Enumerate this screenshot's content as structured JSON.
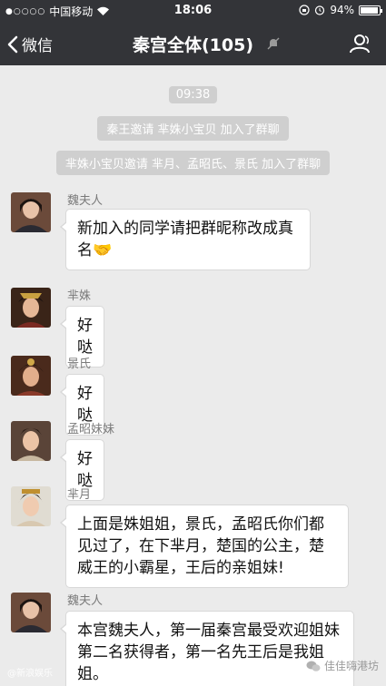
{
  "status_bar": {
    "carrier": "中国移动",
    "time": "18:06",
    "battery_percent": "94%",
    "battery_level": 0.94
  },
  "nav": {
    "back_label": "微信",
    "title": "秦宫全体(105)",
    "icons": [
      "back-chevron-icon",
      "mute-bell-icon",
      "group-members-icon"
    ]
  },
  "chat": {
    "timestamp": "09:38",
    "system_messages": [
      "秦王邀请 芈姝小宝贝 加入了群聊",
      "芈姝小宝贝邀请 芈月、孟昭氏、景氏 加入了群聊"
    ],
    "messages": [
      {
        "sender": "魏夫人",
        "text": "新加入的同学请把群昵称改成真名🤝"
      },
      {
        "sender": "芈姝",
        "text": "好哒"
      },
      {
        "sender": "景氏",
        "text": "好哒"
      },
      {
        "sender": "孟昭妹妹",
        "text": "好哒"
      },
      {
        "sender": "芈月",
        "text": "上面是姝姐姐，景氏，孟昭氏你们都见过了，在下芈月，楚国的公主，楚威王的小霸星，王后的亲姐妹!"
      },
      {
        "sender": "魏夫人",
        "text": "本宫魏夫人，第一届秦宫最受欢迎姐妹第二名获得者，第一名先王后是我姐姐。"
      }
    ]
  },
  "watermarks": {
    "left": "@新浪娱乐",
    "right": "佳佳嗨港坊"
  }
}
